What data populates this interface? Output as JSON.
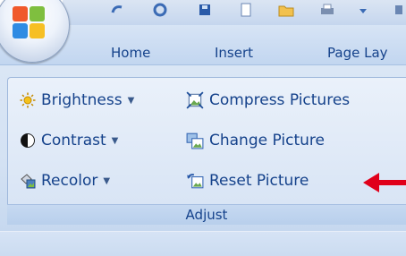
{
  "tabs": [
    "Home",
    "Insert",
    "Page Lay"
  ],
  "commands": {
    "brightness": "Brightness",
    "contrast": "Contrast",
    "recolor": "Recolor",
    "compress": "Compress Pictures",
    "change": "Change Picture",
    "reset": "Reset Picture"
  },
  "group": {
    "label": "Adjust"
  },
  "annotation": {
    "arrow_color": "#e0001a"
  },
  "colors": {
    "accent_text": "#15428b",
    "ribbon_bg": "#dae6f5"
  }
}
